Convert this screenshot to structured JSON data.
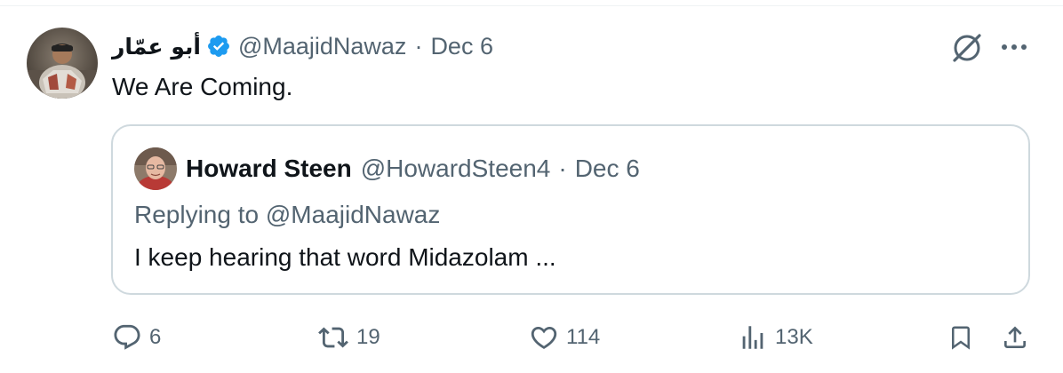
{
  "tweet": {
    "author": {
      "display_name": "أبو عمّار",
      "handle": "@MaajidNawaz",
      "verified": true,
      "avatar_icon": "user-avatar-photo"
    },
    "separator": "·",
    "date": "Dec 6",
    "text": "We Are Coming.",
    "top_right_icons": [
      "grok-icon",
      "more-options-icon"
    ]
  },
  "quoted_tweet": {
    "author": {
      "display_name": "Howard Steen",
      "handle": "@HowardSteen4",
      "avatar_icon": "user-avatar-photo"
    },
    "separator": "·",
    "date": "Dec 6",
    "replying_prefix": "Replying to",
    "replying_handle": "@MaajidNawaz",
    "text": "I keep hearing that word Midazolam ..."
  },
  "actions": {
    "replies": "6",
    "reposts": "19",
    "likes": "114",
    "views": "13K"
  },
  "colors": {
    "text_primary": "#0f1419",
    "text_secondary": "#536471",
    "verified_blue": "#1d9bf0",
    "card_border": "#cfd9de"
  }
}
